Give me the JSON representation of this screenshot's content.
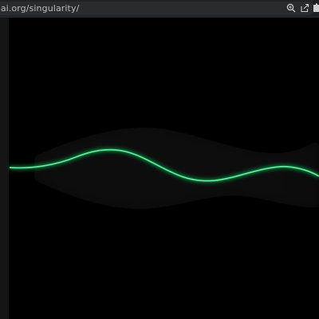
{
  "browser": {
    "url": "oai.org/singularity/",
    "icons": [
      "zoom-icon",
      "share-icon",
      "extension-icon"
    ]
  },
  "visualization": {
    "description_colors": {
      "background": "#000000",
      "wave": "#22e07a",
      "glow": "#0fa855",
      "envelope": "#0b0b0b"
    }
  }
}
